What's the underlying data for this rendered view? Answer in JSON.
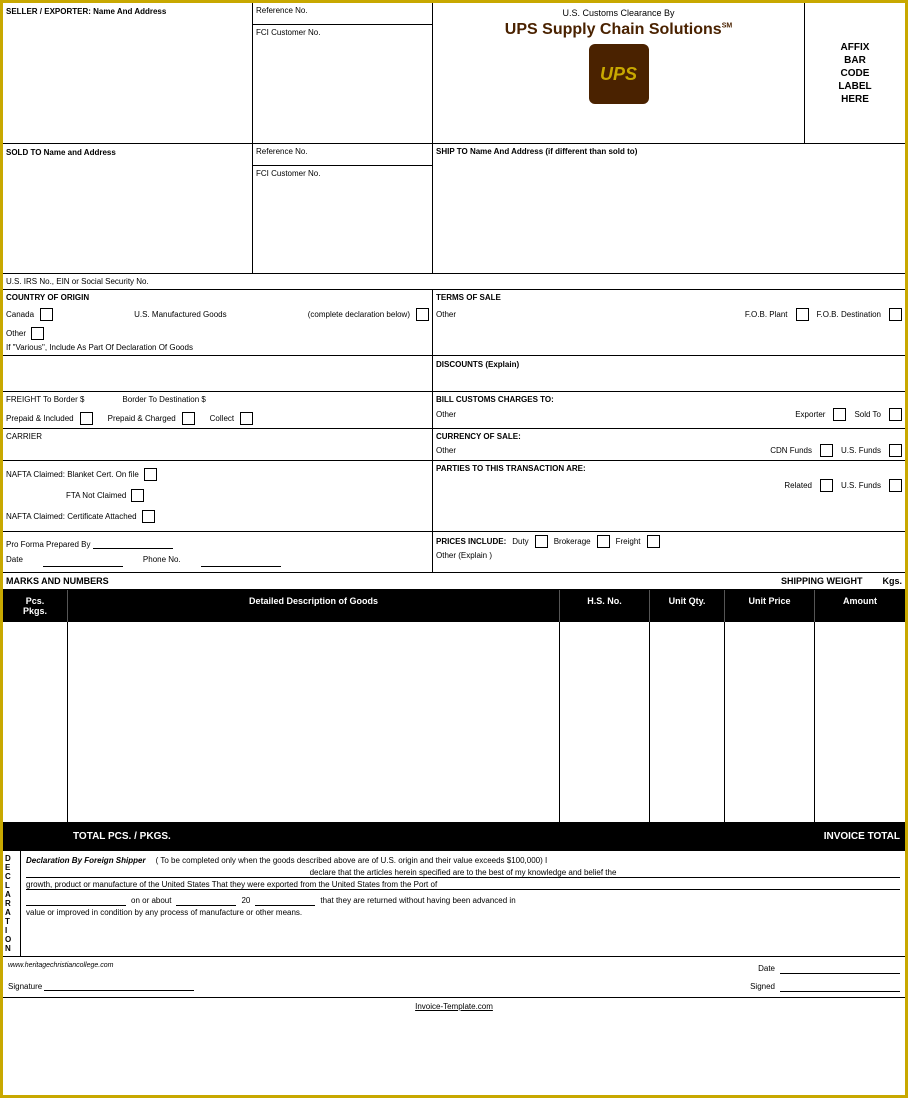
{
  "header": {
    "seller_label": "SELLER / EXPORTER: Name And Address",
    "ref_no_label": "Reference No.",
    "fci_customer_label": "FCI Customer No.",
    "ups_customs_text": "U.S. Customs Clearance By",
    "ups_brand": "UPS Supply Chain Solutions",
    "ups_sm": "SM",
    "ups_logo_text": "ups",
    "barcode_label": "AFFIX\nBAR\nCODE\nLABEL\nHERE"
  },
  "sold_to": {
    "label": "SOLD TO Name and Address",
    "ref_no_label": "Reference No.",
    "fci_customer_label": "FCI Customer No.",
    "ship_to_label": "SHIP TO Name And Address (if different than sold to)",
    "irs_label": "U.S. IRS No., EIN or Social Security No."
  },
  "country_origin": {
    "label": "COUNTRY OF ORIGIN",
    "us_manufactured": "U.S. Manufactured Goods",
    "complete_decl": "(complete declaration below)",
    "canada_label": "Canada",
    "other_label": "Other",
    "various_text": "If \"Various\", Include As Part Of Declaration Of Goods",
    "terms_label": "TERMS OF SALE",
    "other_terms": "Other",
    "fob_plant": "F.O.B. Plant",
    "fob_dest": "F.O.B. Destination"
  },
  "discounts": {
    "label": "DISCOUNTS (Explain)"
  },
  "freight": {
    "label": "FREIGHT To Border $",
    "border_dest": "Border To Destination $",
    "prepaid_included": "Prepaid & Included",
    "prepaid_charged": "Prepaid & Charged",
    "collect": "Collect",
    "bill_customs_label": "BILL CUSTOMS CHARGES TO:",
    "exporter": "Exporter",
    "sold_to": "Sold To",
    "other": "Other"
  },
  "carrier": {
    "label": "CARRIER",
    "currency_label": "CURRENCY OF SALE:",
    "other": "Other",
    "cdn_funds": "CDN Funds",
    "us_funds": "U.S. Funds"
  },
  "nafta": {
    "blanket_label": "NAFTA Claimed: Blanket Cert. On file",
    "fta_not_claimed": "FTA Not Claimed",
    "cert_attached": "NAFTA Claimed: Certificate Attached",
    "parties_label": "PARTIES TO THIS TRANSACTION ARE:",
    "related": "Related",
    "us_funds": "U.S. Funds"
  },
  "proforma": {
    "prepared_label": "Pro Forma Prepared By",
    "date_label": "Date",
    "phone_label": "Phone No.",
    "prices_label": "PRICES INCLUDE:",
    "duty": "Duty",
    "brokerage": "Brokerage",
    "freight": "Freight",
    "other": "Other  (Explain )"
  },
  "marks_row": {
    "label": "MARKS AND NUMBERS",
    "shipping_weight": "SHIPPING WEIGHT",
    "kgs": "Kgs."
  },
  "table": {
    "headers": {
      "pcs_pkgs": "Pcs.\nPkgs.",
      "description": "Detailed Description of Goods",
      "hs_no": "H.S. No.",
      "unit_qty": "Unit Qty.",
      "unit_price": "Unit Price",
      "amount": "Amount"
    },
    "total_pcs_label": "TOTAL PCS. / PKGS.",
    "invoice_total_label": "INVOICE TOTAL"
  },
  "declaration": {
    "sidebar_letters": [
      "D",
      "E",
      "C",
      "L",
      "A",
      "R",
      "A",
      "T",
      "I",
      "O",
      "N"
    ],
    "title": "Declaration By Foreign Shipper",
    "text1": "( To be completed only when the goods described above are of U.S. origin and their value exceeds $100,000)  I",
    "text2": "declare that the articles herein specified are to the best of my knowledge and belief the",
    "text3": "growth, product or manufacture of the United States That they were exported from the United States from the Port of",
    "text4": "on or about",
    "year": "20",
    "text5": "that they are returned without having been advanced in",
    "text6": "value or improved in condition by any process of manufacture or other means."
  },
  "signature": {
    "date_label": "Date",
    "signed_label": "Signed",
    "signature_label": "Signature"
  },
  "footer": {
    "website": "www.heritagechristiancollege.com",
    "invoice_template": "Invoice-Template.com"
  }
}
